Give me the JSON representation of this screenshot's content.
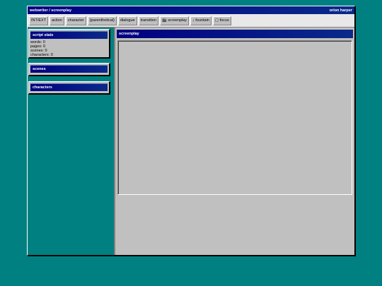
{
  "window": {
    "title": "webwriter / screenplay",
    "user": "orion harper"
  },
  "toolbar": {
    "buttons": [
      {
        "label": "INT/EXT"
      },
      {
        "label": "action"
      },
      {
        "label": "character"
      },
      {
        "label": "(parenthetical)"
      },
      {
        "label": "dialogue"
      },
      {
        "label": "transition"
      },
      {
        "label": "🎬 screenplay"
      },
      {
        "label": "↓ fountain"
      },
      {
        "label": "▢ focus"
      }
    ]
  },
  "sidebar": {
    "stats": {
      "title": "script stats",
      "lines": [
        "words: 0",
        "pages: 0",
        "scenes: 0",
        "characters: 0"
      ]
    },
    "scenes": {
      "title": "scenes"
    },
    "characters": {
      "title": "characters"
    }
  },
  "main": {
    "title": "screenplay",
    "editor_text": ""
  },
  "colors": {
    "desktop": "#008080",
    "titlebar": "#000080",
    "chrome": "#c0c0c0"
  }
}
